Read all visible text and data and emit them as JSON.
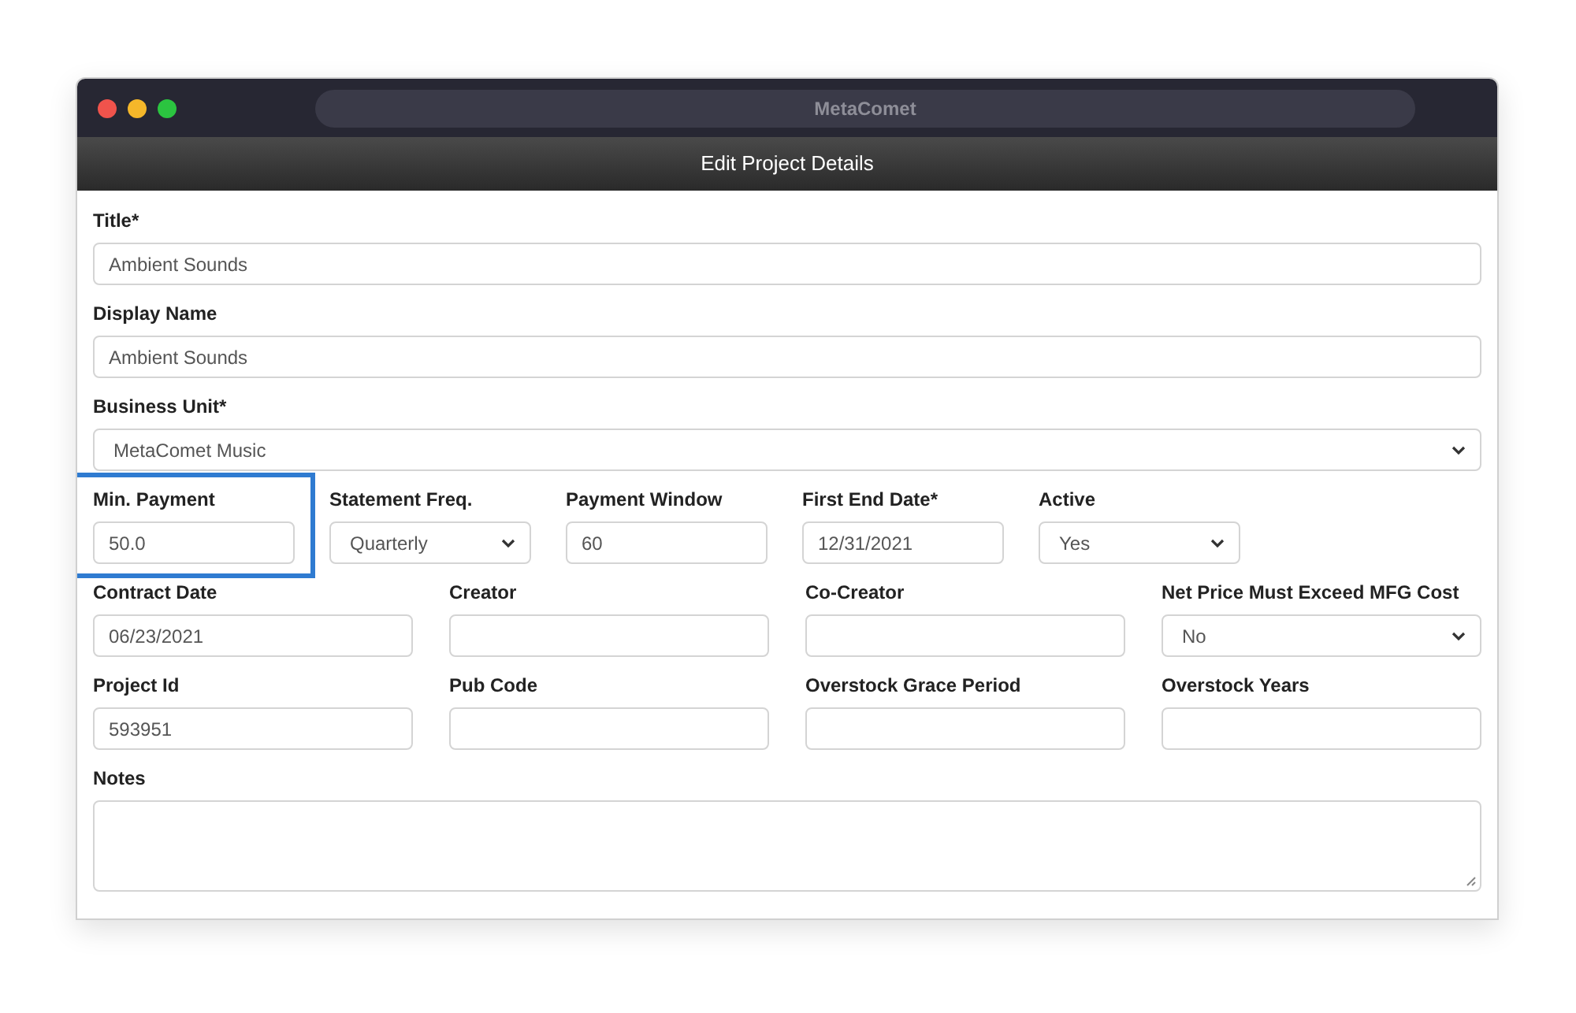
{
  "window": {
    "title": "MetaComet"
  },
  "header": {
    "title": "Edit Project Details"
  },
  "rows": [
    {
      "kind": "full",
      "fields": [
        {
          "label": "Title*",
          "kind": "text",
          "value": "Ambient Sounds",
          "highlighted": false
        }
      ]
    },
    {
      "kind": "full",
      "fields": [
        {
          "label": "Display Name",
          "kind": "text",
          "value": "Ambient Sounds",
          "highlighted": false
        }
      ]
    },
    {
      "kind": "full",
      "fields": [
        {
          "label": "Business Unit*",
          "kind": "select",
          "value": "MetaComet Music",
          "highlighted": false
        }
      ]
    },
    {
      "kind": "five",
      "fields": [
        {
          "label": "Min. Payment",
          "kind": "text",
          "value": "50.0",
          "highlighted": true
        },
        {
          "label": "Statement Freq.",
          "kind": "select",
          "value": "Quarterly",
          "highlighted": false
        },
        {
          "label": "Payment Window",
          "kind": "text",
          "value": "60",
          "highlighted": false
        },
        {
          "label": "First End Date*",
          "kind": "text",
          "value": "12/31/2021",
          "highlighted": false
        },
        {
          "label": "Active",
          "kind": "select",
          "value": "Yes",
          "highlighted": false
        }
      ]
    },
    {
      "kind": "four",
      "fields": [
        {
          "label": "Contract Date",
          "kind": "text",
          "value": "06/23/2021",
          "highlighted": false
        },
        {
          "label": "Creator",
          "kind": "text",
          "highlighted": false
        },
        {
          "label": "Co-Creator",
          "kind": "text",
          "highlighted": false
        },
        {
          "label": "Net Price Must Exceed MFG Cost",
          "kind": "select",
          "value": "No",
          "highlighted": false
        }
      ]
    },
    {
      "kind": "four",
      "fields": [
        {
          "label": "Project Id",
          "kind": "text",
          "value": "593951",
          "highlighted": false
        },
        {
          "label": "Pub Code",
          "kind": "text",
          "highlighted": false
        },
        {
          "label": "Overstock Grace Period",
          "kind": "text",
          "highlighted": false
        },
        {
          "label": "Overstock Years",
          "kind": "text",
          "highlighted": false
        }
      ]
    },
    {
      "kind": "full",
      "fields": [
        {
          "label": "Notes",
          "kind": "textarea",
          "highlighted": false
        }
      ]
    }
  ]
}
